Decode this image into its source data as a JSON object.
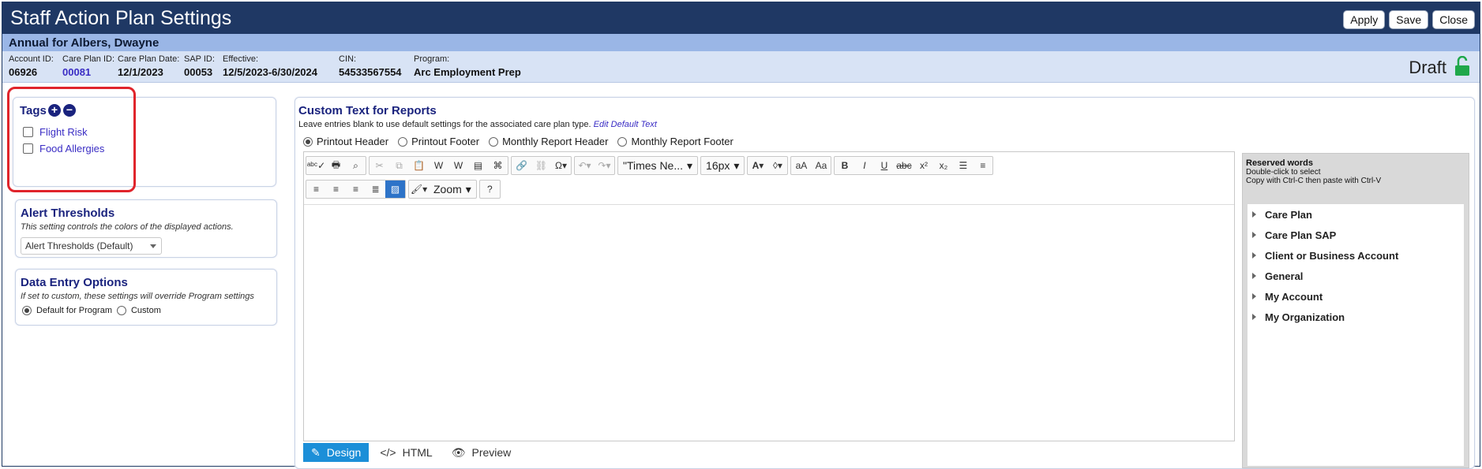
{
  "window": {
    "title": "Staff Action Plan Settings",
    "buttons": {
      "apply": "Apply",
      "save": "Save",
      "close": "Close"
    }
  },
  "subheader": "Annual for Albers, Dwayne",
  "info": {
    "account_id": {
      "label": "Account ID:",
      "value": "06926"
    },
    "care_plan_id": {
      "label": "Care Plan ID:",
      "value": "00081"
    },
    "care_plan_date": {
      "label": "Care Plan Date:",
      "value": "12/1/2023"
    },
    "sap_id": {
      "label": "SAP ID:",
      "value": "00053"
    },
    "effective": {
      "label": "Effective:",
      "value": "12/5/2023-6/30/2024"
    },
    "cin": {
      "label": "CIN:",
      "value": "54533567554"
    },
    "program": {
      "label": "Program:",
      "value": "Arc Employment Prep"
    },
    "status": "Draft"
  },
  "tags": {
    "title": "Tags",
    "items": [
      "Flight Risk",
      "Food Allergies"
    ]
  },
  "alert_thresholds": {
    "title": "Alert Thresholds",
    "desc": "This setting controls the colors of the displayed actions.",
    "selected": "Alert Thresholds (Default)"
  },
  "data_entry": {
    "title": "Data Entry Options",
    "desc": "If set to custom, these settings will override Program settings",
    "opt_default": "Default for Program",
    "opt_custom": "Custom"
  },
  "custom_text": {
    "title": "Custom Text for Reports",
    "desc": "Leave entries blank to use default settings for the associated care plan type.",
    "edit_link": "Edit Default Text",
    "options": [
      "Printout Header",
      "Printout Footer",
      "Monthly Report Header",
      "Monthly Report Footer"
    ],
    "font": "\"Times Ne...",
    "size": "16px",
    "zoom": "Zoom",
    "modes": [
      "Design",
      "HTML",
      "Preview"
    ]
  },
  "reserved": {
    "title": "Reserved words",
    "line1": "Double-click to select",
    "line2": "Copy with Ctrl-C then paste with Ctrl-V",
    "items": [
      "Care Plan",
      "Care Plan SAP",
      "Client or Business Account",
      "General",
      "My Account",
      "My Organization"
    ]
  },
  "colors": {
    "titlebar": "#1f3864",
    "subheader": "#9ab6e6",
    "accent": "#1c8fd8",
    "highlight": "#e0242b"
  }
}
